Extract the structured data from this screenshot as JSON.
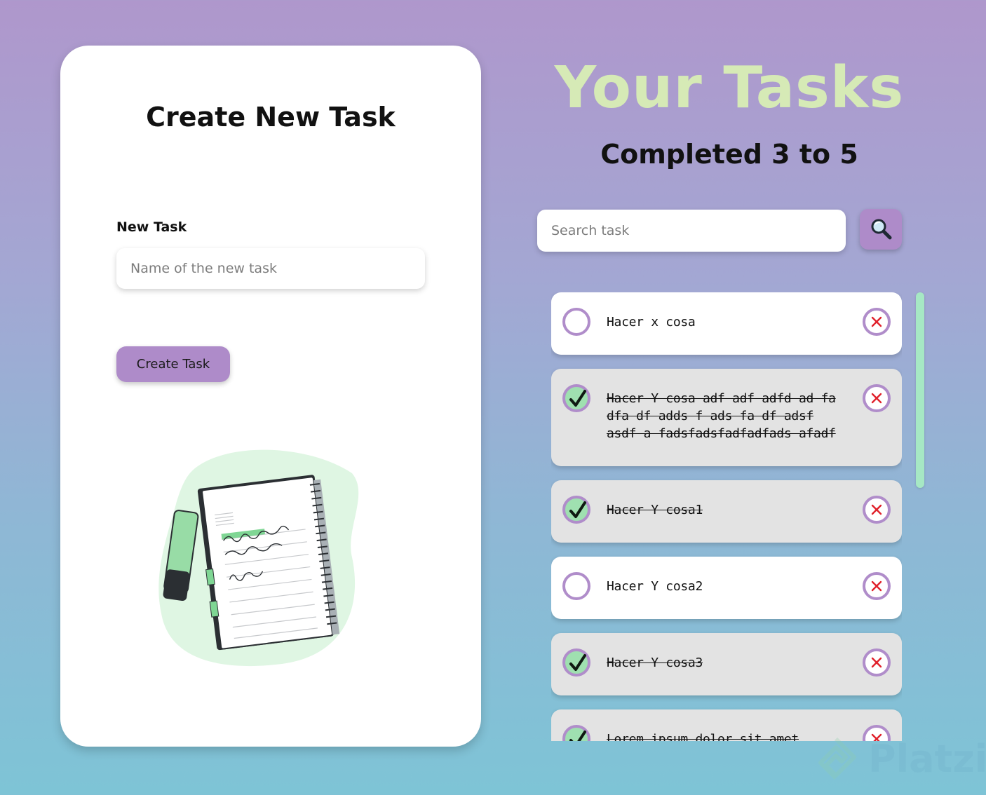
{
  "create_panel": {
    "title": "Create New Task",
    "new_task_label": "New Task",
    "input_placeholder": "Name of the new task",
    "button_label": "Create Task"
  },
  "tasks_panel": {
    "title": "Your Tasks",
    "counter": "Completed 3 to 5",
    "search_placeholder": "Search task",
    "search_icon": "magnifier-icon",
    "tasks": [
      {
        "text": "Hacer x cosa",
        "completed": false
      },
      {
        "text": "Hacer Y cosa adf adf adfd ad fa dfa df adds f ads fa df adsf asdf a fadsfadsfadfadfads afadf",
        "completed": true
      },
      {
        "text": "Hacer Y cosa1",
        "completed": true
      },
      {
        "text": "Hacer Y cosa2",
        "completed": false
      },
      {
        "text": "Hacer Y cosa3",
        "completed": true
      },
      {
        "text": "Lorem ipsum dolor sit amet",
        "completed": true
      }
    ]
  },
  "watermark": "Platzi",
  "colors": {
    "accent": "#ae8bc9",
    "check_done": "#9fe0b0",
    "title_green": "#d6eab6",
    "delete_x": "#e0202a",
    "scrollbar": "#a6e8c4"
  }
}
